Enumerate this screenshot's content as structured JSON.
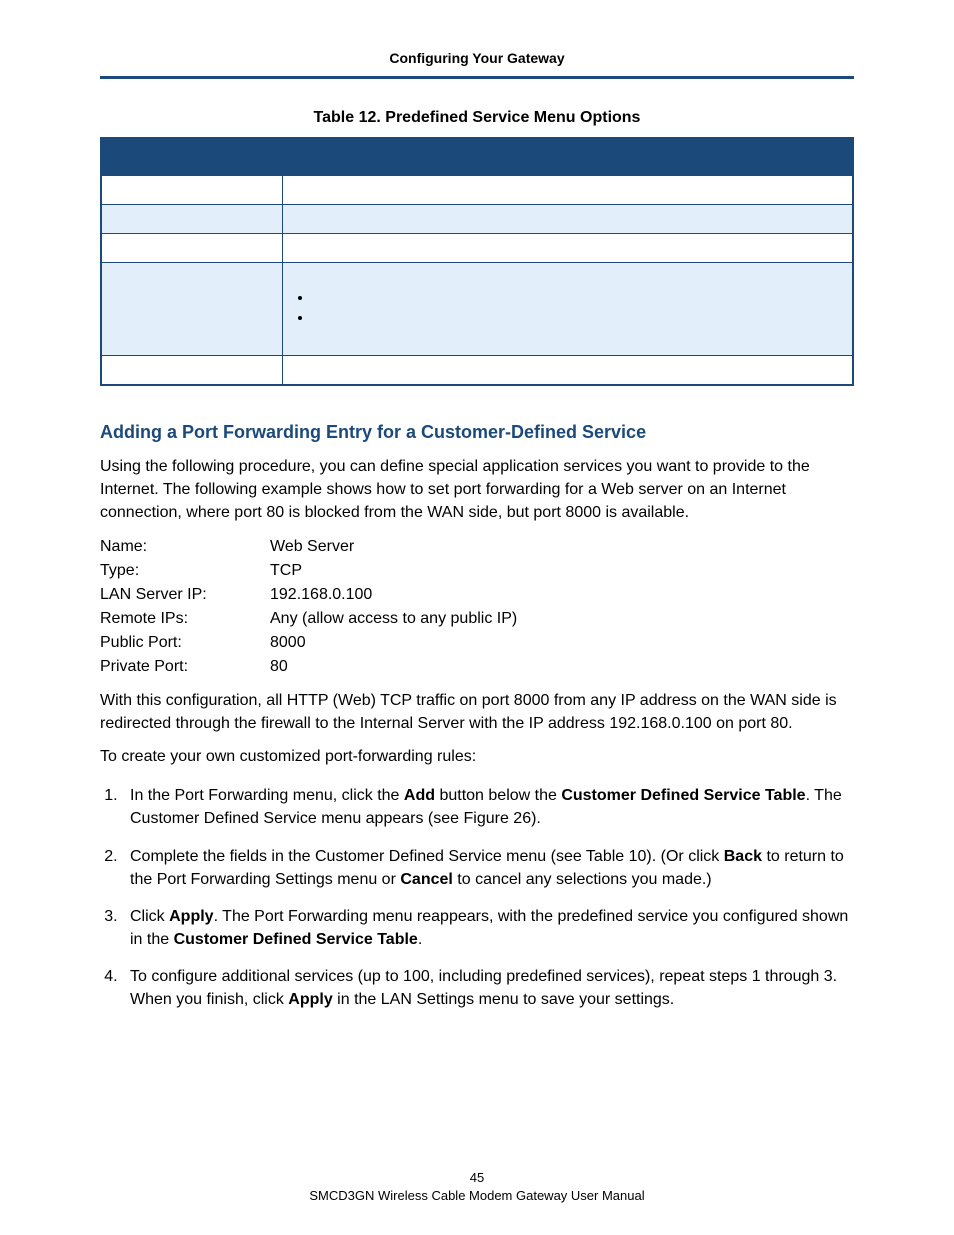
{
  "header": {
    "title": "Configuring Your Gateway"
  },
  "table": {
    "caption": "Table 12. Predefined Service Menu Options",
    "header_option": "",
    "header_desc": ""
  },
  "subhead": "Adding a Port Forwarding Entry for a Customer-Defined Service",
  "para1": "Using the following procedure, you can define special application services you want to provide to the Internet. The following example shows how to set port forwarding for a Web server on an Internet connection, where port 80 is blocked from the WAN side, but port 8000 is available.",
  "kv": {
    "name_k": "Name:",
    "name_v": "Web Server",
    "type_k": "Type:",
    "type_v": "TCP",
    "lan_k": "LAN Server IP:",
    "lan_v": "192.168.0.100",
    "remote_k": "Remote IPs:",
    "remote_v": "Any (allow access to any public IP)",
    "pub_k": "Public Port:",
    "pub_v": "8000",
    "priv_k": "Private Port:",
    "priv_v": "80"
  },
  "para2": "With this configuration, all HTTP (Web) TCP traffic on port 8000 from any IP address on the WAN side is redirected through the firewall to the Internal Server with the IP address 192.168.0.100 on port 80.",
  "para3": "To create your own customized port-forwarding rules:",
  "steps": {
    "s1a": "In the Port Forwarding menu, click the ",
    "s1b_bold": "Add",
    "s1c": " button below the ",
    "s1d_bold": "Customer Defined Service Table",
    "s1e": ". The Customer Defined Service menu appears (see Figure 26).",
    "s2a": "Complete the fields in the Customer Defined Service menu (see Table 10). (Or click ",
    "s2b_bold": "Back",
    "s2c": " to return to the Port Forwarding Settings menu or ",
    "s2d_bold": "Cancel",
    "s2e": " to cancel any selections you made.)",
    "s3a": "Click ",
    "s3b_bold": "Apply",
    "s3c": ". The Port Forwarding menu reappears, with the predefined service you configured shown in the ",
    "s3d_bold": "Customer Defined Service Table",
    "s3e": ".",
    "s4a": "To configure additional services (up to 100, including predefined services), repeat steps 1 through 3. When you finish, click ",
    "s4b_bold": "Apply",
    "s4c": " in the LAN Settings menu to save your settings."
  },
  "footer": {
    "page": "45",
    "line": "SMCD3GN Wireless Cable Modem Gateway User Manual"
  }
}
